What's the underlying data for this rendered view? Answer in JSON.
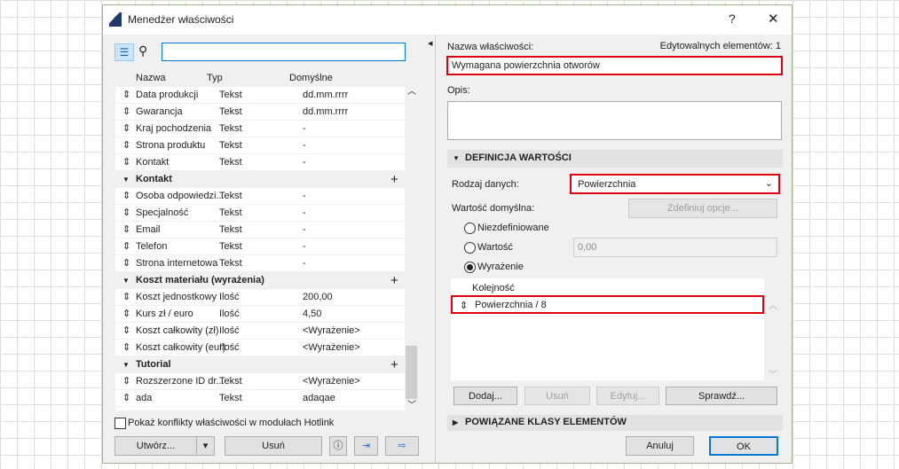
{
  "window": {
    "title": "Menedżer właściwości",
    "help": "?",
    "close": "✕"
  },
  "left": {
    "search_value": "",
    "columns": [
      "Nazwa",
      "Typ",
      "Domyślne"
    ],
    "rows": [
      {
        "kind": "item",
        "name": "Data produkcji",
        "type": "Tekst",
        "default": "dd.mm.rrrr"
      },
      {
        "kind": "item",
        "name": "Gwarancja",
        "type": "Tekst",
        "default": "dd.mm.rrrr"
      },
      {
        "kind": "item",
        "name": "Kraj pochodzenia",
        "type": "Tekst",
        "default": "-"
      },
      {
        "kind": "item",
        "name": "Strona produktu",
        "type": "Tekst",
        "default": "-"
      },
      {
        "kind": "item",
        "name": "Kontakt",
        "type": "Tekst",
        "default": "-"
      },
      {
        "kind": "group",
        "name": "Kontakt"
      },
      {
        "kind": "item",
        "name": "Osoba odpowiedzi...",
        "type": "Tekst",
        "default": "-"
      },
      {
        "kind": "item",
        "name": "Specjalność",
        "type": "Tekst",
        "default": "-"
      },
      {
        "kind": "item",
        "name": "Email",
        "type": "Tekst",
        "default": "-"
      },
      {
        "kind": "item",
        "name": "Telefon",
        "type": "Tekst",
        "default": "-"
      },
      {
        "kind": "item",
        "name": "Strona internetowa",
        "type": "Tekst",
        "default": "-"
      },
      {
        "kind": "group",
        "name": "Koszt materiału (wyrażenia)"
      },
      {
        "kind": "item",
        "name": "Koszt jednostkowy",
        "type": "Ilość",
        "default": "200,00"
      },
      {
        "kind": "item",
        "name": "Kurs zł / euro",
        "type": "Ilość",
        "default": "4,50"
      },
      {
        "kind": "item",
        "name": "Koszt całkowity (zł)",
        "type": "Ilość",
        "default": "<Wyrażenie>"
      },
      {
        "kind": "item",
        "name": "Koszt całkowity (eur)",
        "type": "Ilość",
        "default": "<Wyrażenie>"
      },
      {
        "kind": "group",
        "name": "Tutorial"
      },
      {
        "kind": "item",
        "name": "Rozszerzone ID dr...",
        "type": "Tekst",
        "default": "<Wyrażenie>"
      },
      {
        "kind": "item",
        "name": "ada",
        "type": "Tekst",
        "default": "adaqae"
      }
    ],
    "hotlink_checkbox": "Pokaż konflikty właściwości w modułach Hotlink",
    "create": "Utwórz...",
    "delete": "Usuń"
  },
  "right": {
    "name_label": "Nazwa właściwości:",
    "editable_count": "Edytowalnych elementów: 1",
    "name_value": "Wymagana powierzchnia otworów",
    "desc_label": "Opis:",
    "desc_value": "",
    "section_def": "DEFINICJA WARTOŚCI",
    "data_type_label": "Rodzaj danych:",
    "data_type_value": "Powierzchnia",
    "default_label": "Wartość domyślna:",
    "define_options": "Zdefiniuj opcje...",
    "radios": [
      "Niezdefiniowane",
      "Wartość",
      "Wyrażenie"
    ],
    "selected_radio": "Wyrażenie",
    "value_field": "0,00",
    "order_header": "Kolejność",
    "expression": "Powierzchnia / 8",
    "add": "Dodaj...",
    "remove": "Usuń",
    "edit": "Edytuj...",
    "check": "Sprawdź...",
    "section_classes": "POWIĄZANE KLASY ELEMENTÓW",
    "cancel": "Anuluj",
    "ok": "OK"
  },
  "colors": {
    "highlight": "#e00010",
    "accent": "#0078d7"
  }
}
